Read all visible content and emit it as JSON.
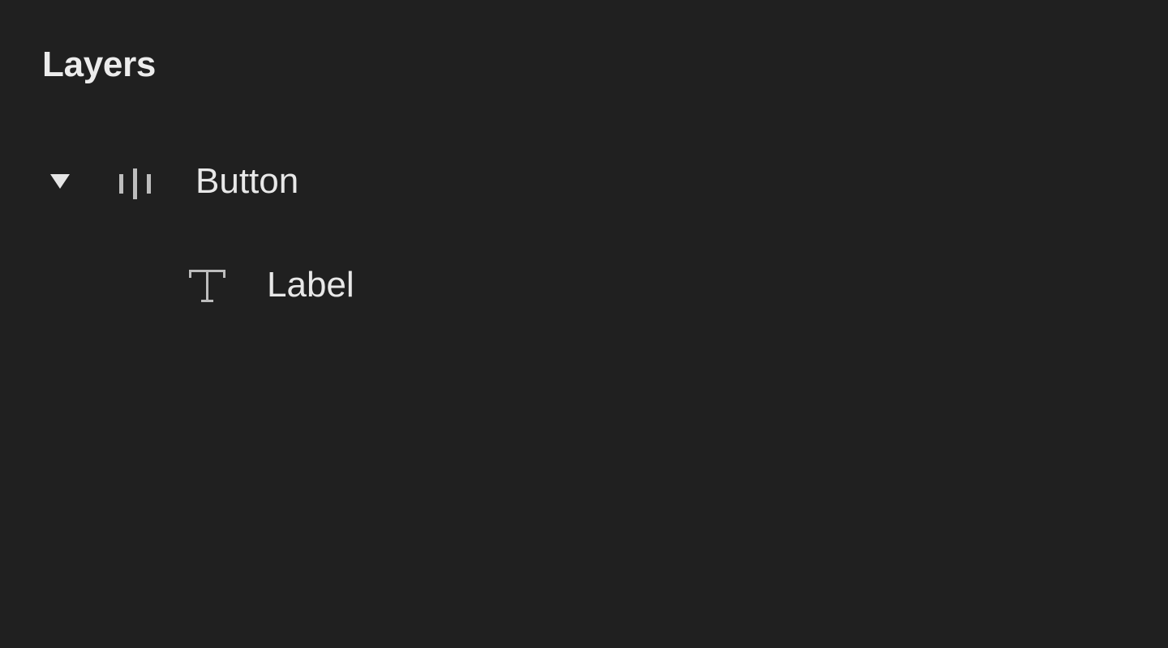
{
  "panel": {
    "title": "Layers"
  },
  "layers": [
    {
      "name": "Button",
      "icon": "distribute-horizontal-icon",
      "expanded": true,
      "depth": 0
    },
    {
      "name": "Label",
      "icon": "text-icon",
      "depth": 1
    }
  ],
  "colors": {
    "background": "#202020",
    "text": "#e8e8e8",
    "icon": "#bdbdbd"
  }
}
